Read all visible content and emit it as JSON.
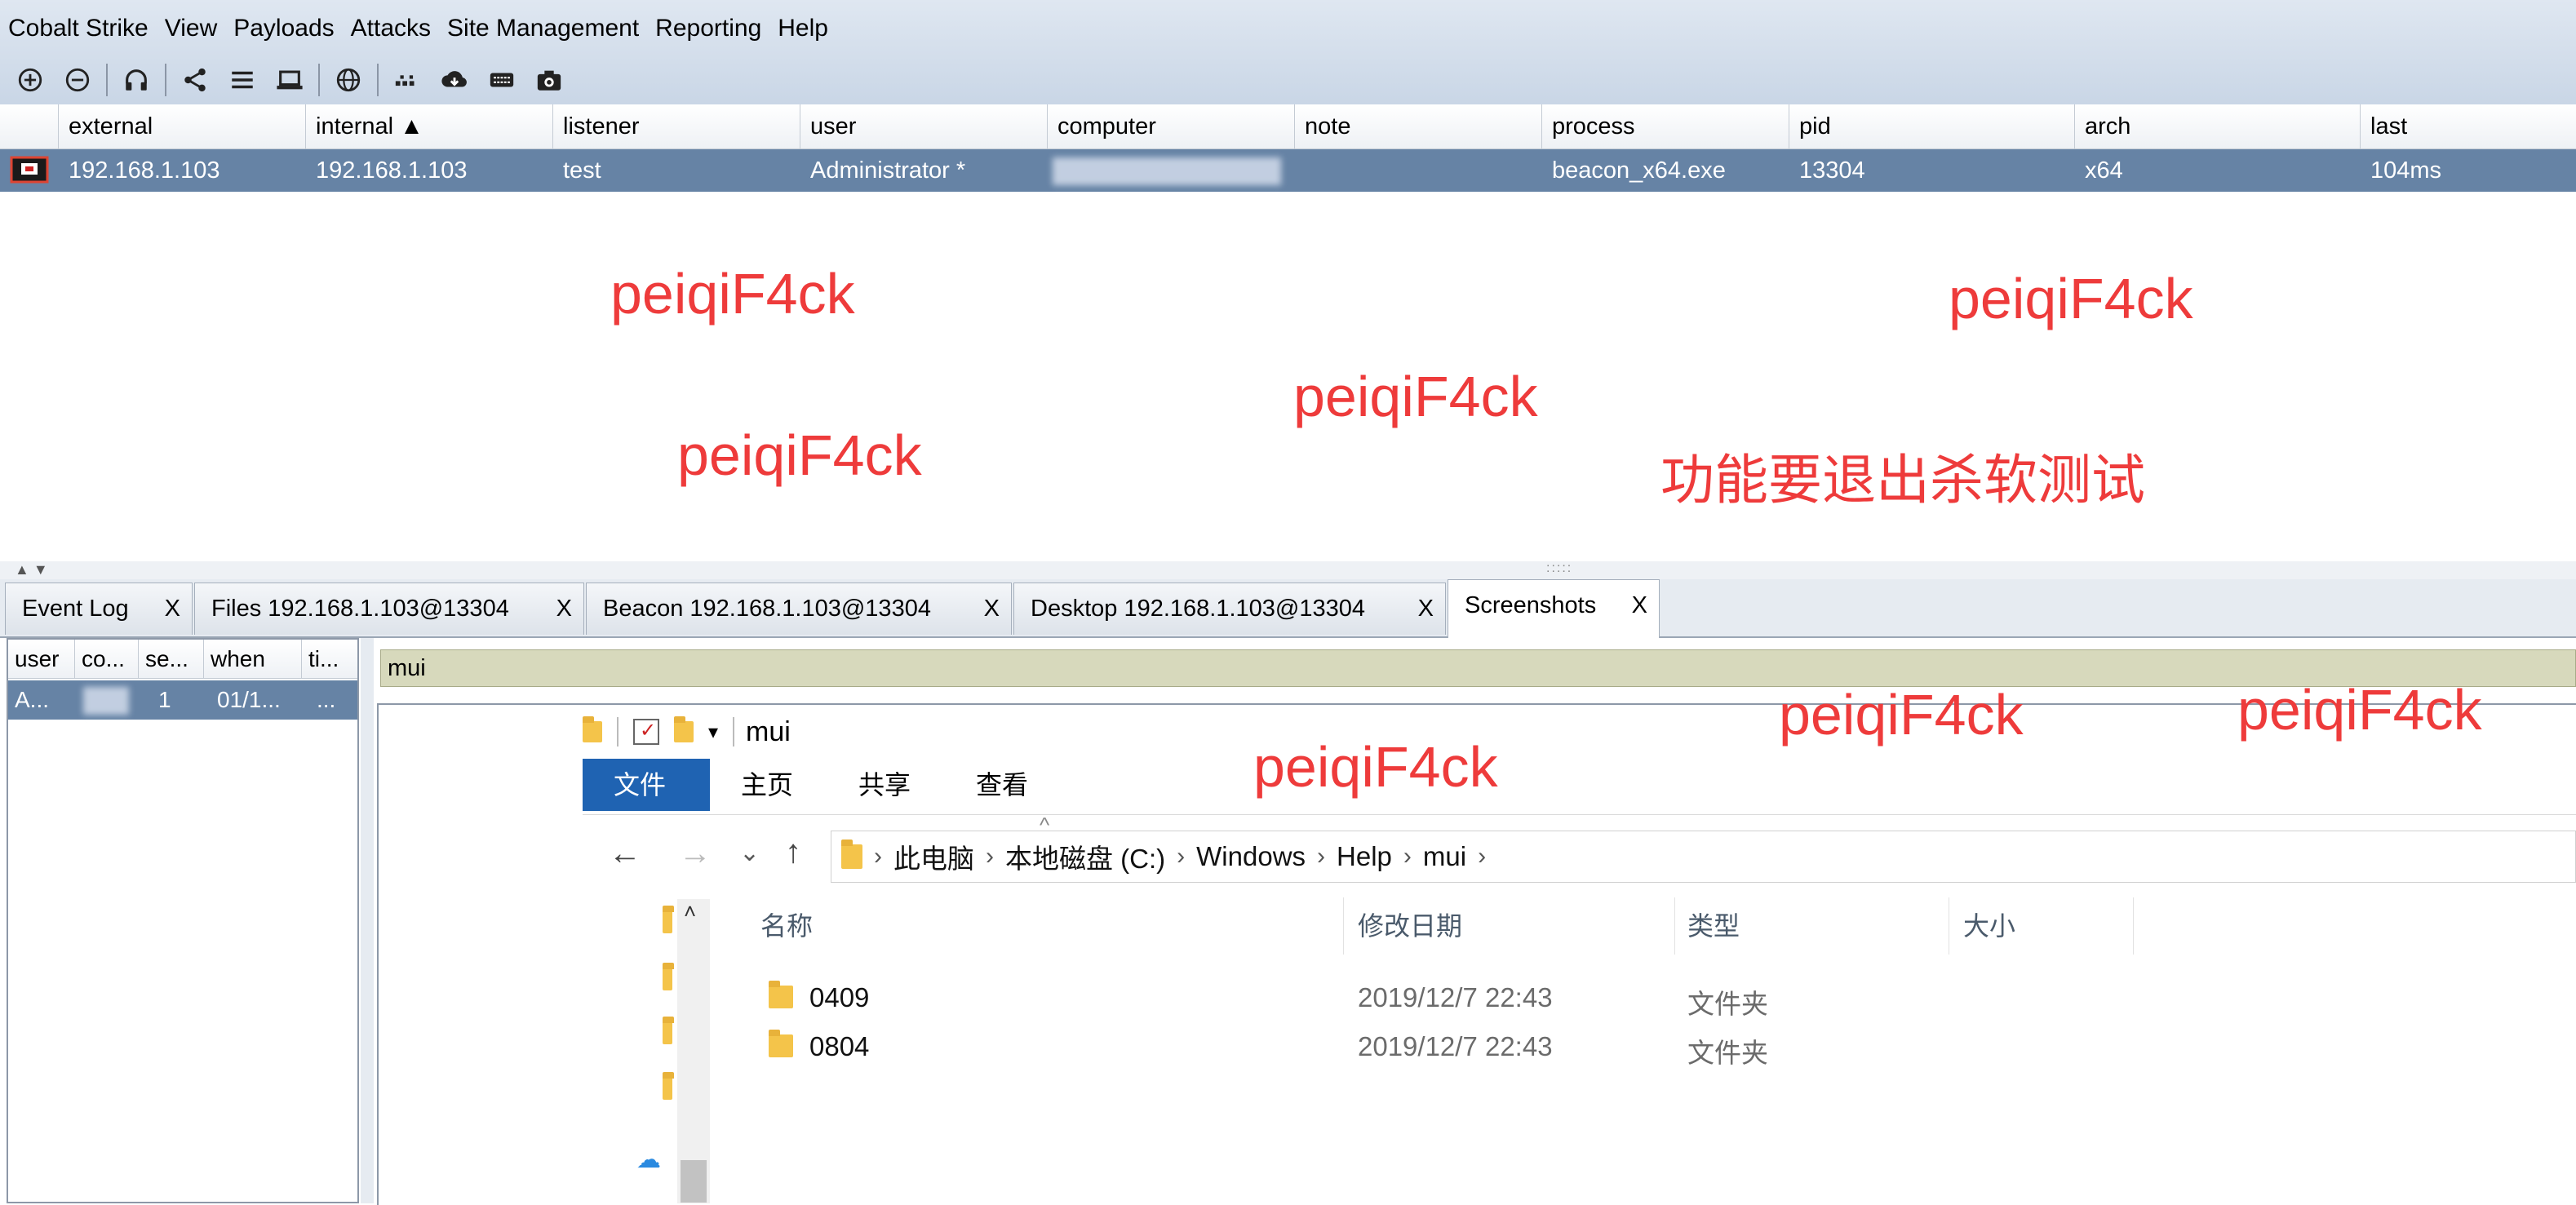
{
  "menu": [
    "Cobalt Strike",
    "View",
    "Payloads",
    "Attacks",
    "Site Management",
    "Reporting",
    "Help"
  ],
  "toolbar_icons": [
    "connect-icon",
    "disconnect-icon",
    "listeners-icon",
    "pivot-graph-icon",
    "session-table-icon",
    "targets-icon",
    "web-drive-icon",
    "credentials-icon",
    "downloads-icon",
    "keystrokes-icon",
    "screenshots-icon"
  ],
  "sessions": {
    "columns": [
      "external",
      "internal ▲",
      "listener",
      "user",
      "computer",
      "note",
      "process",
      "pid",
      "arch",
      "last"
    ],
    "row": {
      "external": "192.168.1.103",
      "internal": "192.168.1.103",
      "listener": "test",
      "user": "Administrator *",
      "computer": "",
      "note": "",
      "process": "beacon_x64.exe",
      "pid": "13304",
      "arch": "x64",
      "last": "104ms"
    }
  },
  "watermarks": {
    "w1": "peiqiF4ck",
    "w2": "peiqiF4ck",
    "w3": "peiqiF4ck",
    "w4": "peiqiF4ck",
    "note": "功能要退出杀软测试",
    "w5": "peiqiF4ck",
    "w6": "peiqiF4ck",
    "w7": "peiqiF4ck"
  },
  "tabs": [
    {
      "label": "Event Log",
      "close": "X"
    },
    {
      "label": "Files 192.168.1.103@13304",
      "close": "X"
    },
    {
      "label": "Beacon 192.168.1.103@13304",
      "close": "X"
    },
    {
      "label": "Desktop 192.168.1.103@13304",
      "close": "X"
    },
    {
      "label": "Screenshots",
      "close": "X"
    }
  ],
  "screenshots_table": {
    "columns": [
      "user",
      "co...",
      "se...",
      "when",
      "ti..."
    ],
    "row": {
      "user": "A...",
      "computer": "",
      "session": "1",
      "when": "01/1...",
      "title": "..."
    }
  },
  "address_value": "mui",
  "explorer": {
    "title": "mui",
    "ribbon": {
      "file": "文件",
      "home": "主页",
      "share": "共享",
      "view": "查看"
    },
    "breadcrumb": [
      "此电脑",
      "本地磁盘 (C:)",
      "Windows",
      "Help",
      "mui"
    ],
    "columns": {
      "name": "名称",
      "modified": "修改日期",
      "type": "类型",
      "size": "大小"
    },
    "rows": [
      {
        "name": "0409",
        "modified": "2019/12/7 22:43",
        "type": "文件夹"
      },
      {
        "name": "0804",
        "modified": "2019/12/7 22:43",
        "type": "文件夹"
      }
    ]
  }
}
